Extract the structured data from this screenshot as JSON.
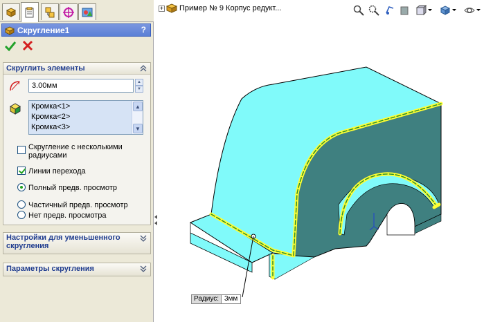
{
  "feature_manager": {
    "title": "Скругление1",
    "help": "?",
    "ok_icon": "green-check-icon",
    "cancel_icon": "red-x-icon",
    "tabs": [
      "feature-manager-icon",
      "property-manager-icon",
      "configuration-manager-icon",
      "dimxpert-icon",
      "display-manager-icon"
    ],
    "fillet_items": {
      "title": "Скруглить элементы",
      "radius_value": "3.00мм",
      "edges": [
        "Кромка<1>",
        "Кромка<2>",
        "Кромка<3>"
      ],
      "options": {
        "multiple_radius": "Скругление с несколькими радиусами",
        "tangent_propagation": "Линии перехода",
        "full_preview": "Полный предв. просмотр",
        "partial_preview": "Частичный предв. просмотр",
        "no_preview": "Нет предв. просмотра"
      }
    },
    "setback_title": "Настройки для уменьшенного скругления",
    "fillet_options_title": "Параметры скругления"
  },
  "graphics": {
    "part_name": "Пример № 9 Корпус редукт...",
    "tree_expander": "+",
    "callout_label": "Радиус:",
    "callout_value": "3мм",
    "colors": {
      "model_top": "#80fafa",
      "model_side": "#3f8080",
      "edge_highlight": "#ffff33",
      "accent": "#5a7fd6"
    }
  }
}
